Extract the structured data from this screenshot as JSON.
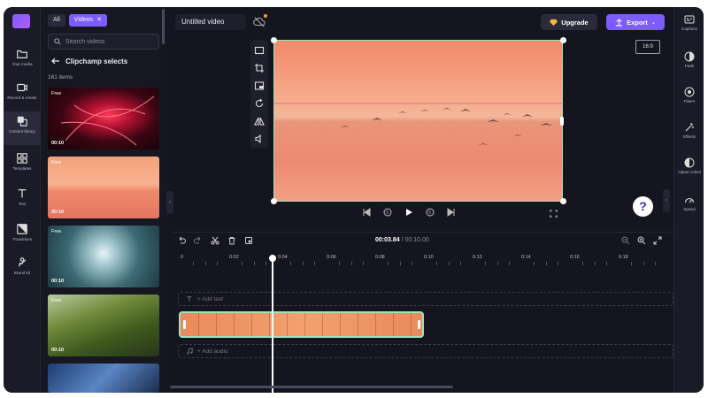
{
  "panel": {
    "chips": [
      {
        "label": "All"
      },
      {
        "label": "Videos"
      }
    ],
    "search_placeholder": "Search videos",
    "back_label": "Clipchamp selects",
    "count": "161 items",
    "thumbnails": [
      {
        "badge": "Free",
        "duration": "00:10"
      },
      {
        "badge": "Free",
        "duration": "00:10"
      },
      {
        "badge": "Free",
        "duration": "00:10"
      },
      {
        "badge": "Free",
        "duration": "00:10"
      }
    ]
  },
  "rail": {
    "items": [
      {
        "label": "Your media",
        "icon": "folder-icon"
      },
      {
        "label": "Record & create",
        "icon": "camera-icon"
      },
      {
        "label": "Content library",
        "icon": "library-icon"
      },
      {
        "label": "Templates",
        "icon": "templates-icon"
      },
      {
        "label": "Text",
        "icon": "text-icon"
      },
      {
        "label": "Transitions",
        "icon": "transitions-icon"
      },
      {
        "label": "Brand kit",
        "icon": "brand-kit-icon"
      }
    ]
  },
  "header": {
    "title": "Untitled video",
    "upgrade_label": "Upgrade",
    "export_label": "Export",
    "ratio": "16:9"
  },
  "right_rail": {
    "items": [
      {
        "label": "Captions",
        "icon": "captions-icon"
      },
      {
        "label": "Fade",
        "icon": "fade-icon"
      },
      {
        "label": "Filters",
        "icon": "filters-icon"
      },
      {
        "label": "Effects",
        "icon": "effects-icon"
      },
      {
        "label": "Adjust colors",
        "icon": "adjust-colors-icon"
      },
      {
        "label": "Speed",
        "icon": "speed-icon"
      }
    ]
  },
  "help": {
    "label": "?"
  },
  "timeline": {
    "current_time": "00:03.84",
    "total_time": "/ 00:10.00",
    "ruler": [
      "0",
      "0:02",
      "0:04",
      "0:06",
      "0:08",
      "0:10",
      "0:12",
      "0:14",
      "0:16",
      "0:18"
    ],
    "add_text": "+ Add text",
    "add_audio": "+ Add audio"
  },
  "colors": {
    "accent": "#7c5cff",
    "selection": "#9ee0c0",
    "background": "#15151f"
  }
}
